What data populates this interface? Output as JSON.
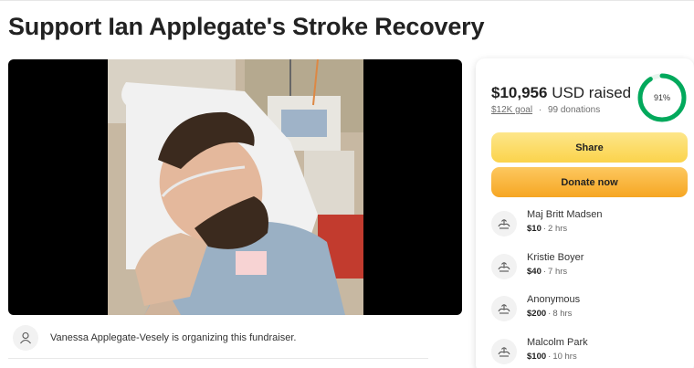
{
  "page": {
    "title": "Support Ian Applegate's Stroke Recovery"
  },
  "organizer": {
    "text": "Vanessa Applegate-Vesely is organizing this fundraiser.",
    "icon": "person-icon"
  },
  "progress": {
    "amount_raised": "$10,956",
    "currency_label": "USD raised",
    "goal": "$12K goal",
    "separator": "·",
    "donations": "99 donations",
    "percent_label": "91%",
    "percent": 0.91
  },
  "buttons": {
    "share": "Share",
    "donate": "Donate now"
  },
  "donations": [
    {
      "name": "Maj Britt Madsen",
      "amount": "$10",
      "time": "2 hrs"
    },
    {
      "name": "Kristie Boyer",
      "amount": "$40",
      "time": "7 hrs"
    },
    {
      "name": "Anonymous",
      "amount": "$200",
      "time": "8 hrs"
    },
    {
      "name": "Malcolm Park",
      "amount": "$100",
      "time": "10 hrs"
    }
  ],
  "colors": {
    "accent_green": "#02a95c",
    "share_yellow": "#fbd34b",
    "donate_orange": "#f6a623"
  }
}
